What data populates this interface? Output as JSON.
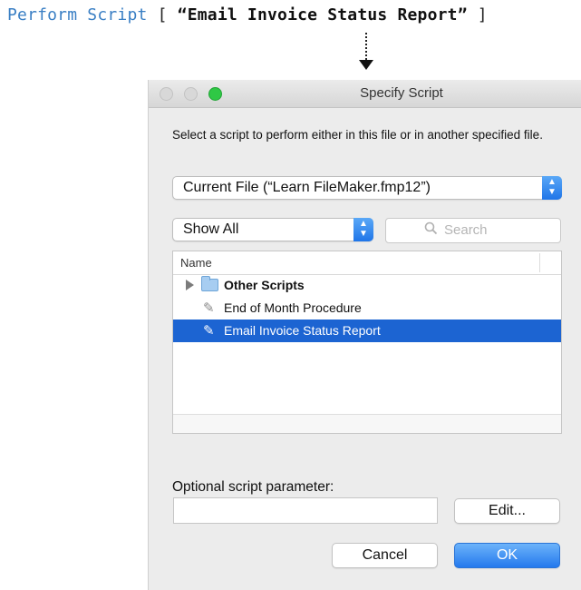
{
  "script_step": {
    "name": "Perform Script",
    "open_bracket": "[",
    "argument": "“Email Invoice Status Report”",
    "close_bracket": "]"
  },
  "dialog": {
    "title": "Specify Script",
    "instructions": "Select a script to perform either in this file or in another specified file.",
    "file_popup_value": "Current File (“Learn FileMaker.fmp12”)",
    "filter_popup_value": "Show All",
    "search_placeholder": "Search",
    "list": {
      "column_header": "Name",
      "rows": [
        {
          "label": "Other Scripts",
          "kind": "folder",
          "selected": false
        },
        {
          "label": "End of Month Procedure",
          "kind": "script",
          "selected": false
        },
        {
          "label": "Email Invoice Status Report",
          "kind": "script",
          "selected": true
        }
      ]
    },
    "parameter_label": "Optional script parameter:",
    "parameter_value": "",
    "edit_button": "Edit...",
    "cancel_button": "Cancel",
    "ok_button": "OK"
  },
  "icons": {
    "arrow": "dotted-down-arrow-icon",
    "folder": "folder-icon",
    "script": "script-icon",
    "search": "search-icon",
    "stepper": "chevron-up-down-icon"
  },
  "colors": {
    "step_name": "#3a7fc4",
    "selection": "#1c64d2",
    "zoom_button": "#2fc845",
    "ok_button": "#2479ed"
  }
}
